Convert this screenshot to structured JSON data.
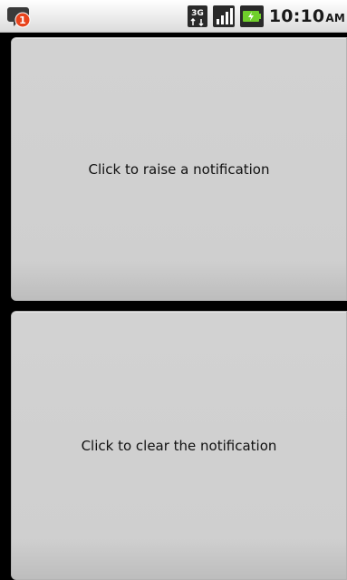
{
  "status_bar": {
    "notification_count": "1",
    "network_type": "3G",
    "time": "10:10",
    "ampm": "AM",
    "icons": [
      "chat-notification-icon",
      "network-3g-icon",
      "signal-strength-icon",
      "battery-charging-icon"
    ]
  },
  "main": {
    "raise_label": "Click to raise a notification",
    "clear_label": "Click to clear the notification"
  }
}
